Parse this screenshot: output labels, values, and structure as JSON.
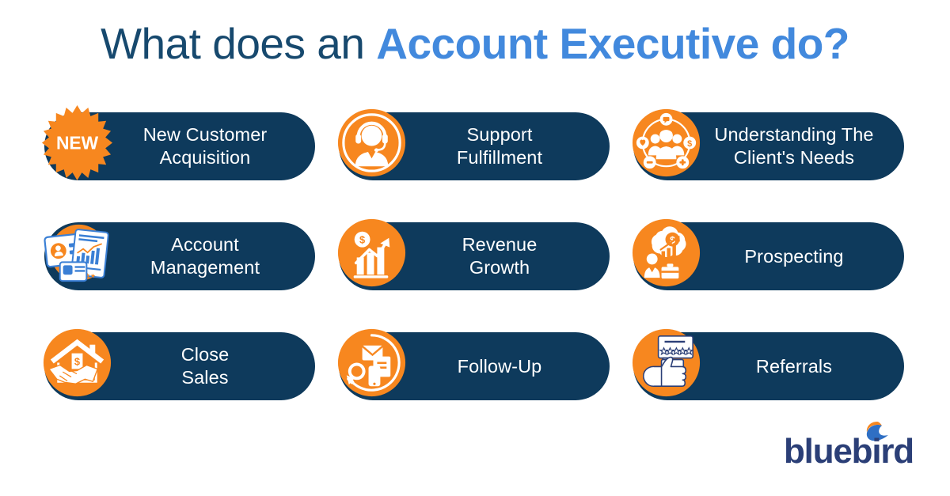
{
  "title": {
    "part1": "What does an ",
    "part2": "Account Executive do?",
    "color_part1": "#17496e",
    "color_part2": "#4289dd"
  },
  "theme": {
    "navy": "#0e3a5c",
    "orange": "#f7871f",
    "accent_blue": "#4289dd",
    "background": "#ffffff",
    "label_text": "#ffffff"
  },
  "cards": [
    {
      "id": "new-customer-acquisition",
      "line1": "New Customer",
      "line2": "Acquisition",
      "icon": "new-burst-icon",
      "badge_text": "NEW"
    },
    {
      "id": "support-fulfillment",
      "line1": "Support",
      "line2": "Fulfillment",
      "icon": "headset-agent-icon"
    },
    {
      "id": "understanding-the-clients-needs",
      "line1": "Understanding The",
      "line2": "Client's Needs",
      "icon": "client-network-icon"
    },
    {
      "id": "account-management",
      "line1": "Account",
      "line2": "Management",
      "icon": "account-cards-icon"
    },
    {
      "id": "revenue-growth",
      "line1": "Revenue",
      "line2": "Growth",
      "icon": "revenue-chart-icon"
    },
    {
      "id": "prospecting",
      "line1": "Prospecting",
      "line2": "",
      "icon": "prospecting-icon"
    },
    {
      "id": "close-sales",
      "line1": "Close",
      "line2": "Sales",
      "icon": "handshake-house-icon"
    },
    {
      "id": "follow-up",
      "line1": "Follow-Up",
      "line2": "",
      "icon": "follow-up-icon"
    },
    {
      "id": "referrals",
      "line1": "Referrals",
      "line2": "",
      "icon": "thumbs-up-review-icon"
    }
  ],
  "logo": {
    "wordmark": "bluebird",
    "mark": "bluebird-swoosh-icon",
    "word_color": "#2b3f77",
    "swoosh_orange": "#f7871f",
    "swoosh_blue": "#2f6fc4"
  }
}
